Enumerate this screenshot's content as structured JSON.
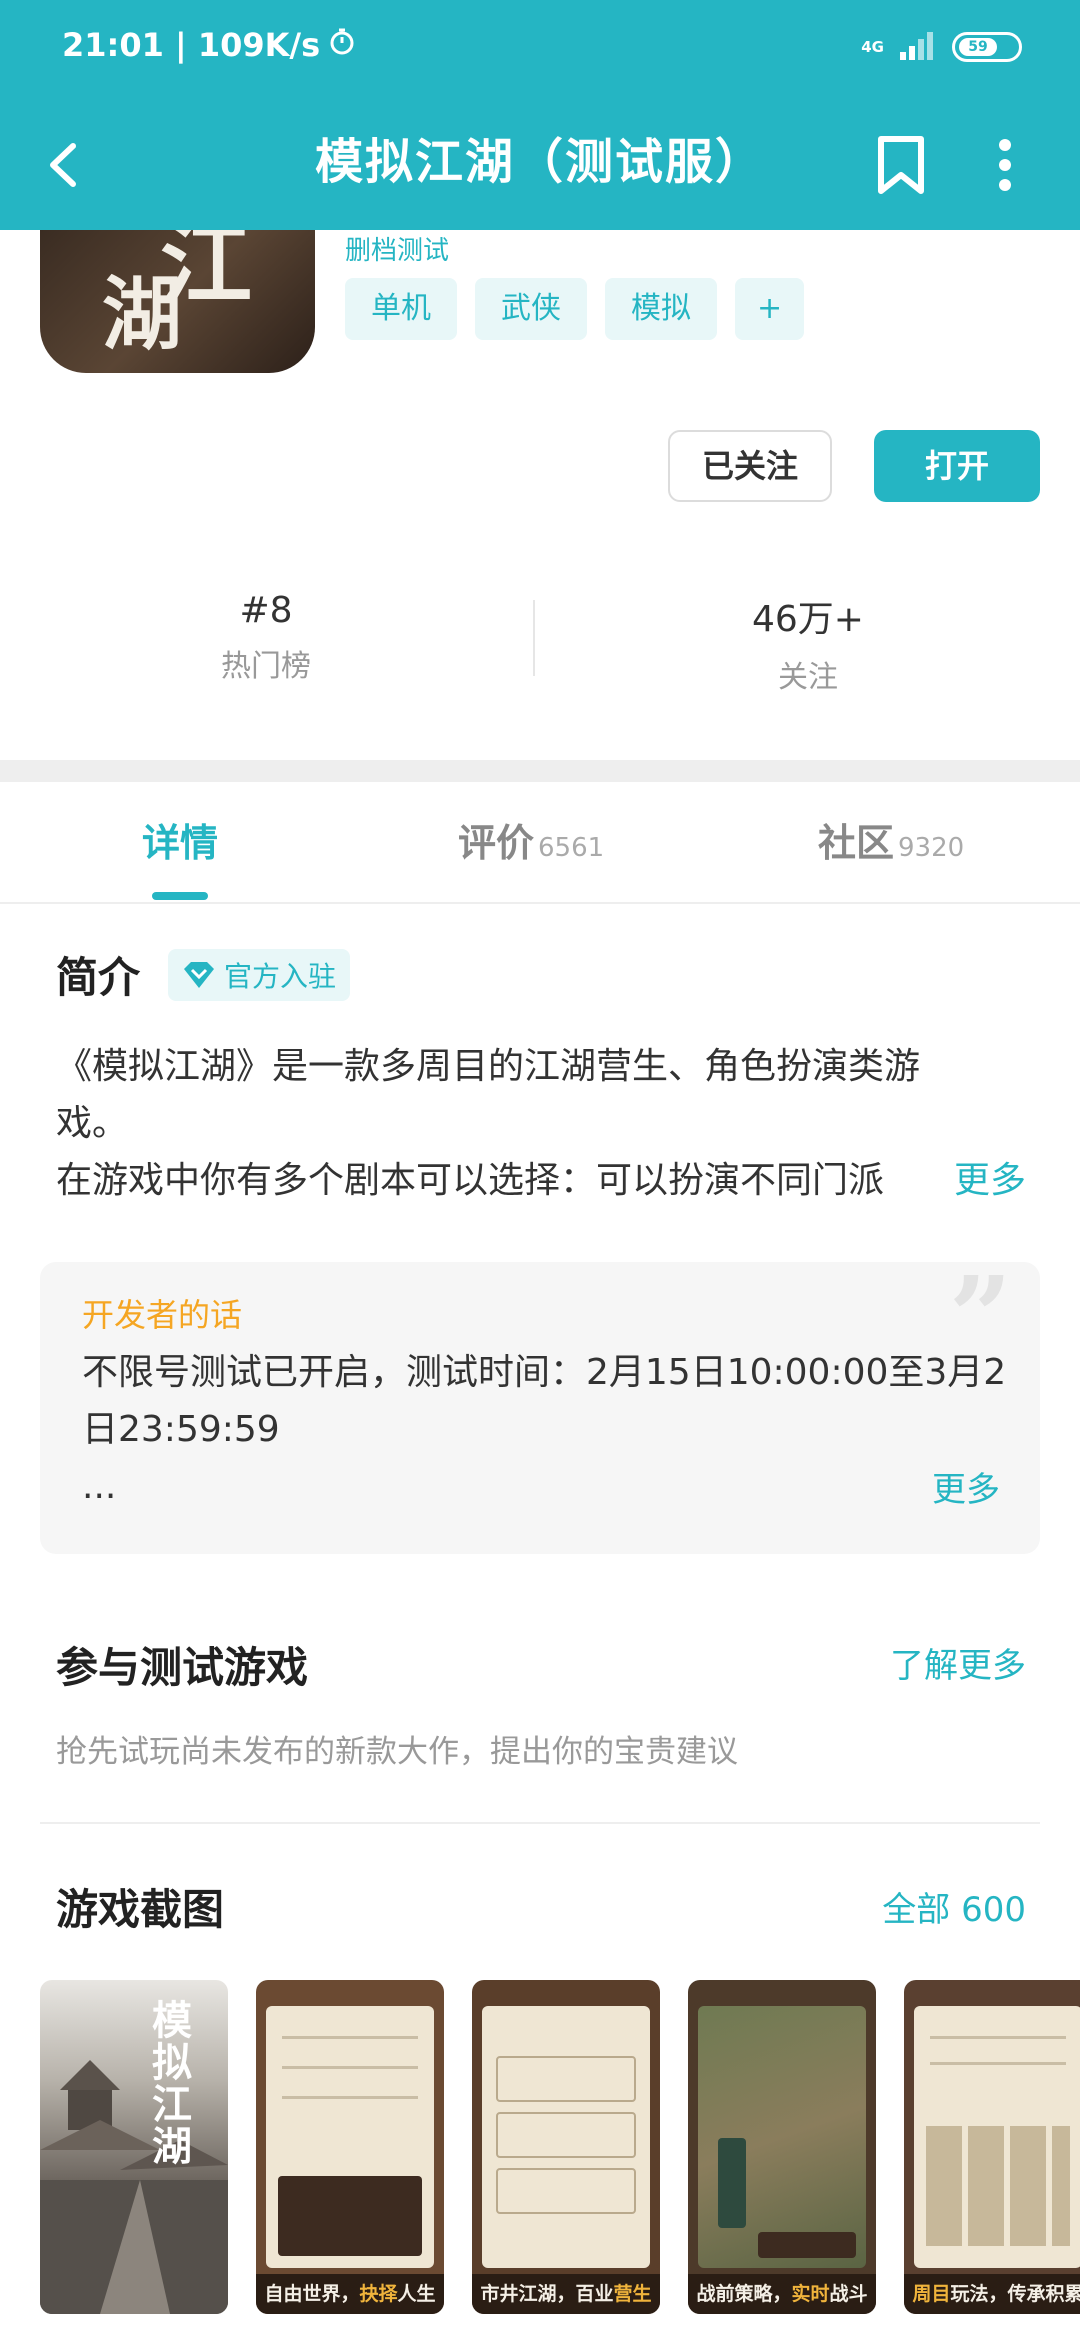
{
  "status_bar": {
    "time_speed": "21:01 | 109K/s",
    "network": "4G",
    "battery": "59"
  },
  "nav": {
    "title": "模拟江湖（测试服）"
  },
  "app": {
    "icon_text_1": "江",
    "icon_text_2": "湖",
    "subtitle": "删档测试",
    "tags": [
      "单机",
      "武侠",
      "模拟",
      "+"
    ],
    "follow_label": "已关注",
    "open_label": "打开",
    "rank_value": "#8",
    "rank_label": "热门榜",
    "followers_value": "46万+",
    "followers_label": "关注"
  },
  "tabs": [
    {
      "label": "详情",
      "count": ""
    },
    {
      "label": "评价",
      "count": "6561"
    },
    {
      "label": "社区",
      "count": "9320"
    }
  ],
  "intro": {
    "title": "简介",
    "badge": "官方入驻",
    "line1": "《模拟江湖》是一款多周目的江湖营生、角色扮演类游",
    "line2": "戏。",
    "line3": "在游戏中你有多个剧本可以选择：可以扮演不同门派",
    "more": "更多"
  },
  "developer": {
    "title": "开发者的话",
    "text": "不限号测试已开启，测试时间：2月15日10:00:00至3月2日23:59:59",
    "ellipsis": "...",
    "more": "更多",
    "quote": "”"
  },
  "beta": {
    "title": "参与测试游戏",
    "more": "了解更多",
    "desc": "抢先试玩尚未发布的新款大作，提出你的宝贵建议"
  },
  "screenshots": {
    "title": "游戏截图",
    "all": "全部 600",
    "cover_text": "模拟江湖",
    "captions": [
      {
        "pre": "",
        "hl": "",
        "post": ""
      },
      {
        "pre": "自由世界，",
        "hl": "抉择",
        "post": "人生"
      },
      {
        "pre": "市井江湖，百业",
        "hl": "营生",
        "post": ""
      },
      {
        "pre": "战前策略，",
        "hl": "实时",
        "post": "战斗"
      },
      {
        "pre": "",
        "hl": "周目",
        "post": "玩法，传承积累"
      }
    ]
  },
  "colors": {
    "accent": "#25b5c3",
    "tag_bg": "#e8f7f8",
    "dev_title": "#f5a623"
  }
}
